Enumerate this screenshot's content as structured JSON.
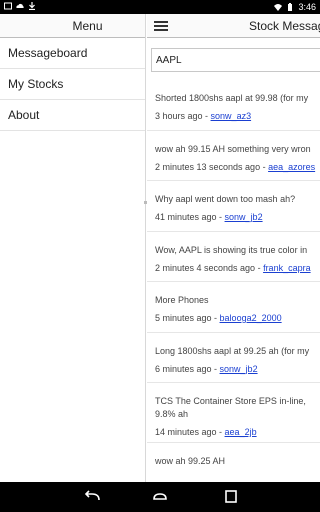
{
  "status_bar": {
    "time": "3:46"
  },
  "drawer": {
    "title": "Menu",
    "items": [
      {
        "label": "Messageboard"
      },
      {
        "label": "My Stocks"
      },
      {
        "label": "About"
      }
    ]
  },
  "header": {
    "title": "Stock Messag"
  },
  "search": {
    "value": "AAPL"
  },
  "messages": [
    {
      "text": "Shorted 1800shs aapl at 99.98 (for my",
      "time": "3 hours ago - ",
      "user": "sonw_az3"
    },
    {
      "text": "wow ah 99.15 AH something very wron",
      "time": "2 minutes 13 seconds ago - ",
      "user": "aea_azores"
    },
    {
      "text": "Why aapl went down too mash ah?",
      "time": "41 minutes ago - ",
      "user": "sonw_jb2"
    },
    {
      "text": "Wow, AAPL is showing its true color in",
      "time": "2 minutes 4 seconds ago - ",
      "user": "frank_capra"
    },
    {
      "text": "More Phones",
      "time": "5 minutes ago - ",
      "user": "balooga2_2000"
    },
    {
      "text": "Long 1800shs aapl at 99.25 ah (for my",
      "time": "6 minutes ago - ",
      "user": "sonw_jb2"
    },
    {
      "text": "TCS The Container Store EPS in-line,",
      "text2": "9.8% ah",
      "time": "14 minutes ago - ",
      "user": "aea_2jb"
    },
    {
      "text": "wow ah 99.25 AH",
      "time": "",
      "user": ""
    }
  ],
  "colors": {
    "link": "#1a3fd1",
    "divider": "#e6e6e6"
  }
}
